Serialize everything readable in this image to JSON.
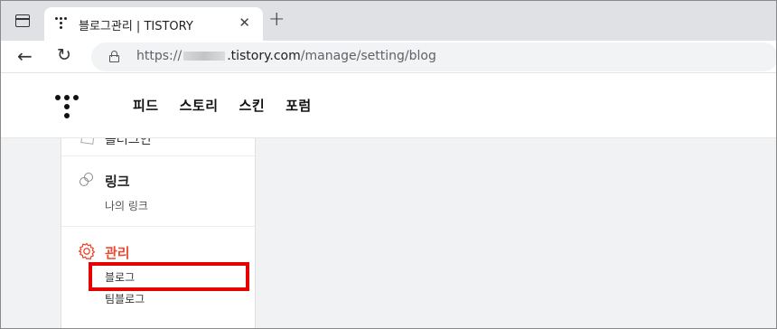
{
  "browser": {
    "tab_title": "블로그관리 | TISTORY",
    "tab_close": "✕",
    "new_tab": "+",
    "back_icon": "←",
    "reload_icon": "↻",
    "url_prefix": "https://",
    "url_host": ".tistory.com",
    "url_path": "/manage/setting/blog"
  },
  "header": {
    "nav": [
      "피드",
      "스토리",
      "스킨",
      "포럼"
    ]
  },
  "sidebar": {
    "cut_label": "플러그인",
    "link_title": "링크",
    "link_sub": "나의 링크",
    "manage_title": "관리",
    "manage_items": [
      "블로그",
      "팀블로그"
    ]
  },
  "colors": {
    "accent": "#eb4a2f",
    "highlight": "#e60000"
  }
}
